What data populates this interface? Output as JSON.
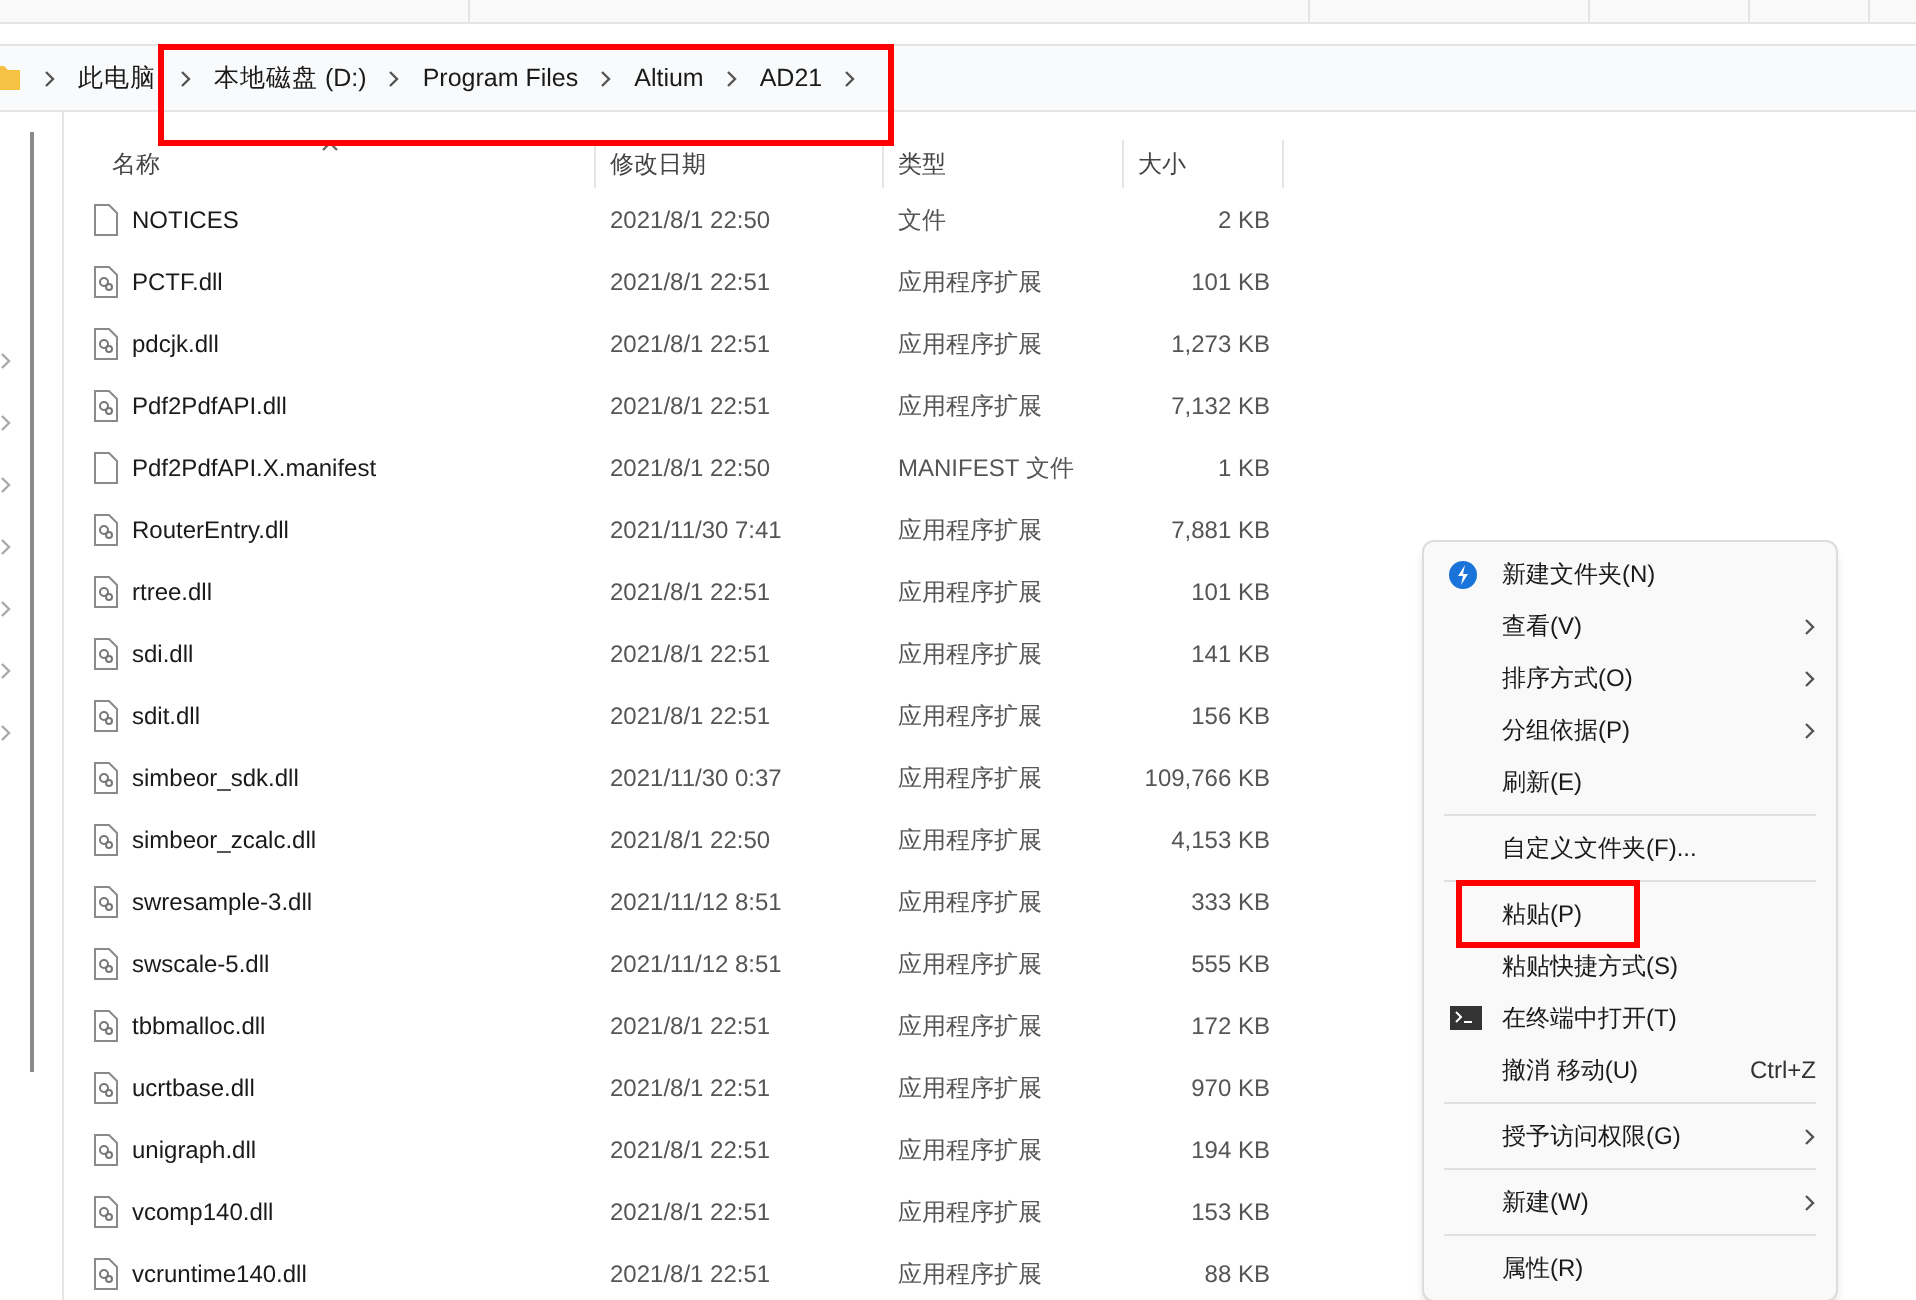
{
  "breadcrumb": [
    "此电脑",
    "本地磁盘 (D:)",
    "Program Files",
    "Altium",
    "AD21"
  ],
  "table": {
    "columns": [
      {
        "label": "名称",
        "sorted": true
      },
      {
        "label": "修改日期",
        "sorted": false
      },
      {
        "label": "类型",
        "sorted": false
      },
      {
        "label": "大小",
        "sorted": false
      }
    ],
    "rows": [
      {
        "name": "NOTICES",
        "kind": "file",
        "date": "2021/8/1 22:50",
        "type": "文件",
        "size": "2 KB"
      },
      {
        "name": "PCTF.dll",
        "kind": "dll",
        "date": "2021/8/1 22:51",
        "type": "应用程序扩展",
        "size": "101 KB"
      },
      {
        "name": "pdcjk.dll",
        "kind": "dll",
        "date": "2021/8/1 22:51",
        "type": "应用程序扩展",
        "size": "1,273 KB"
      },
      {
        "name": "Pdf2PdfAPI.dll",
        "kind": "dll",
        "date": "2021/8/1 22:51",
        "type": "应用程序扩展",
        "size": "7,132 KB"
      },
      {
        "name": "Pdf2PdfAPI.X.manifest",
        "kind": "file",
        "date": "2021/8/1 22:50",
        "type": "MANIFEST 文件",
        "size": "1 KB"
      },
      {
        "name": "RouterEntry.dll",
        "kind": "dll",
        "date": "2021/11/30 7:41",
        "type": "应用程序扩展",
        "size": "7,881 KB"
      },
      {
        "name": "rtree.dll",
        "kind": "dll",
        "date": "2021/8/1 22:51",
        "type": "应用程序扩展",
        "size": "101 KB"
      },
      {
        "name": "sdi.dll",
        "kind": "dll",
        "date": "2021/8/1 22:51",
        "type": "应用程序扩展",
        "size": "141 KB"
      },
      {
        "name": "sdit.dll",
        "kind": "dll",
        "date": "2021/8/1 22:51",
        "type": "应用程序扩展",
        "size": "156 KB"
      },
      {
        "name": "simbeor_sdk.dll",
        "kind": "dll",
        "date": "2021/11/30 0:37",
        "type": "应用程序扩展",
        "size": "109,766 KB"
      },
      {
        "name": "simbeor_zcalc.dll",
        "kind": "dll",
        "date": "2021/8/1 22:50",
        "type": "应用程序扩展",
        "size": "4,153 KB"
      },
      {
        "name": "swresample-3.dll",
        "kind": "dll",
        "date": "2021/11/12 8:51",
        "type": "应用程序扩展",
        "size": "333 KB"
      },
      {
        "name": "swscale-5.dll",
        "kind": "dll",
        "date": "2021/11/12 8:51",
        "type": "应用程序扩展",
        "size": "555 KB"
      },
      {
        "name": "tbbmalloc.dll",
        "kind": "dll",
        "date": "2021/8/1 22:51",
        "type": "应用程序扩展",
        "size": "172 KB"
      },
      {
        "name": "ucrtbase.dll",
        "kind": "dll",
        "date": "2021/8/1 22:51",
        "type": "应用程序扩展",
        "size": "970 KB"
      },
      {
        "name": "unigraph.dll",
        "kind": "dll",
        "date": "2021/8/1 22:51",
        "type": "应用程序扩展",
        "size": "194 KB"
      },
      {
        "name": "vcomp140.dll",
        "kind": "dll",
        "date": "2021/8/1 22:51",
        "type": "应用程序扩展",
        "size": "153 KB"
      },
      {
        "name": "vcruntime140.dll",
        "kind": "dll",
        "date": "2021/8/1 22:51",
        "type": "应用程序扩展",
        "size": "88 KB"
      }
    ]
  },
  "context_menu": [
    {
      "kind": "folder-item",
      "label": "新建文件夹(N)",
      "submenu": false
    },
    {
      "kind": "item",
      "label": "查看(V)",
      "submenu": true
    },
    {
      "kind": "item",
      "label": "排序方式(O)",
      "submenu": true
    },
    {
      "kind": "item",
      "label": "分组依据(P)",
      "submenu": true
    },
    {
      "kind": "item",
      "label": "刷新(E)",
      "submenu": false
    },
    {
      "kind": "separator"
    },
    {
      "kind": "item",
      "label": "自定义文件夹(F)...",
      "submenu": false
    },
    {
      "kind": "separator"
    },
    {
      "kind": "item",
      "label": "粘贴(P)",
      "submenu": false,
      "highlighted": true
    },
    {
      "kind": "item",
      "label": "粘贴快捷方式(S)",
      "submenu": false
    },
    {
      "kind": "terminal-item",
      "label": "在终端中打开(T)",
      "submenu": false
    },
    {
      "kind": "item",
      "label": "撤消 移动(U)",
      "shortcut": "Ctrl+Z",
      "submenu": false
    },
    {
      "kind": "separator"
    },
    {
      "kind": "item",
      "label": "授予访问权限(G)",
      "submenu": true
    },
    {
      "kind": "separator"
    },
    {
      "kind": "item",
      "label": "新建(W)",
      "submenu": true
    },
    {
      "kind": "separator"
    },
    {
      "kind": "item",
      "label": "属性(R)",
      "submenu": false
    }
  ],
  "address_bar_highlighted": true
}
